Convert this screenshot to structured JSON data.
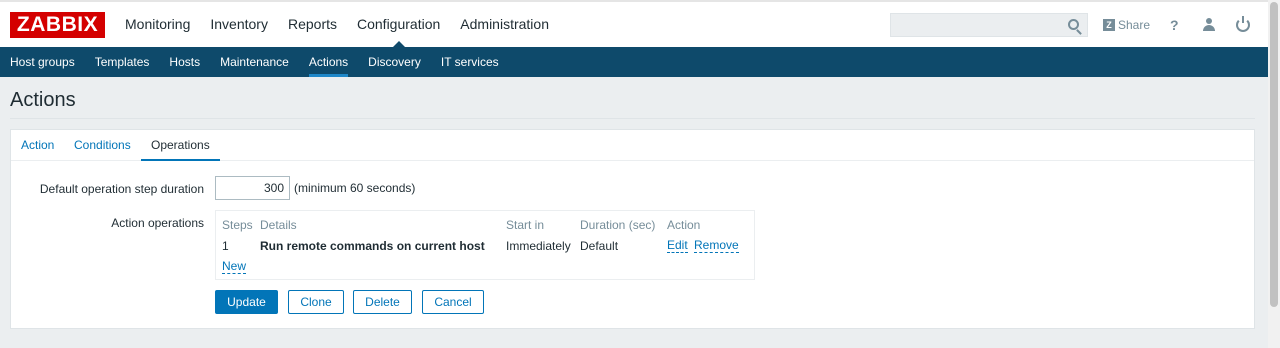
{
  "logo": "ZABBIX",
  "main_menu": [
    {
      "label": "Monitoring",
      "active": false
    },
    {
      "label": "Inventory",
      "active": false
    },
    {
      "label": "Reports",
      "active": false
    },
    {
      "label": "Configuration",
      "active": true
    },
    {
      "label": "Administration",
      "active": false
    }
  ],
  "header": {
    "search_value": "",
    "share_label": "Share",
    "help_label": "?"
  },
  "sub_menu": [
    {
      "label": "Host groups",
      "active": false
    },
    {
      "label": "Templates",
      "active": false
    },
    {
      "label": "Hosts",
      "active": false
    },
    {
      "label": "Maintenance",
      "active": false
    },
    {
      "label": "Actions",
      "active": true
    },
    {
      "label": "Discovery",
      "active": false
    },
    {
      "label": "IT services",
      "active": false
    }
  ],
  "page_title": "Actions",
  "tabs": [
    {
      "label": "Action",
      "active": false
    },
    {
      "label": "Conditions",
      "active": false
    },
    {
      "label": "Operations",
      "active": true
    }
  ],
  "form": {
    "step_duration_label": "Default operation step duration",
    "step_duration_value": "300",
    "step_duration_hint": "(minimum 60 seconds)",
    "operations_label": "Action operations"
  },
  "operations": {
    "headers": {
      "steps": "Steps",
      "details": "Details",
      "start_in": "Start in",
      "duration": "Duration (sec)",
      "action": "Action"
    },
    "rows": [
      {
        "steps": "1",
        "details": "Run remote commands on current host",
        "start_in": "Immediately",
        "duration": "Default",
        "edit": "Edit",
        "remove": "Remove"
      }
    ],
    "new_link": "New"
  },
  "buttons": {
    "update": "Update",
    "clone": "Clone",
    "delete": "Delete",
    "cancel": "Cancel"
  },
  "colors": {
    "header_blue": "#0e4a6b",
    "link_blue": "#0275b8",
    "logo_red": "#d40000"
  }
}
